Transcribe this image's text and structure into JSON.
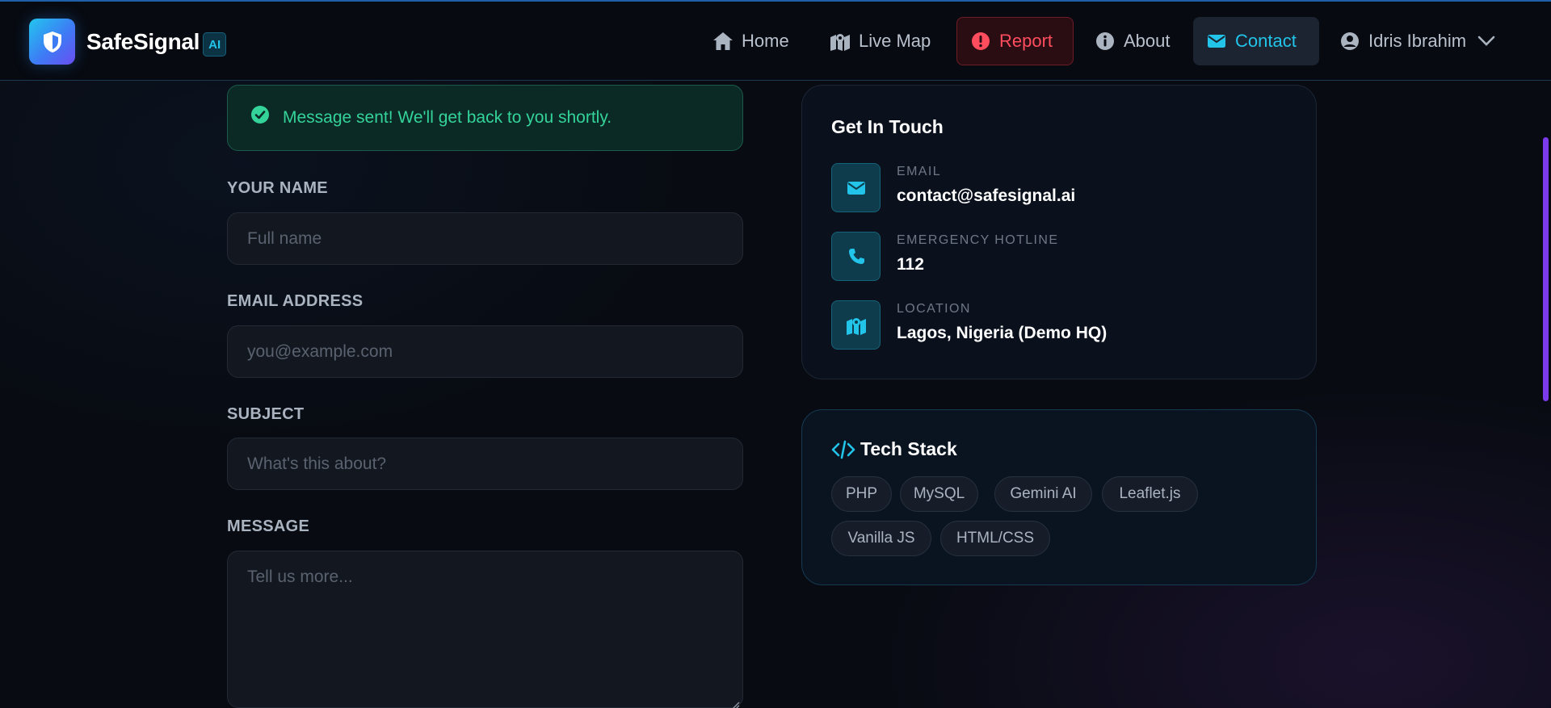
{
  "brand": {
    "name": "SafeSignal",
    "badge": "AI"
  },
  "nav": {
    "home": "Home",
    "live_map": "Live Map",
    "report": "Report",
    "about": "About",
    "contact": "Contact",
    "user": "Idris Ibrahim"
  },
  "alert": {
    "message": "Message sent! We'll get back to you shortly."
  },
  "form": {
    "name_label": "YOUR NAME",
    "name_placeholder": "Full name",
    "email_label": "EMAIL ADDRESS",
    "email_placeholder": "you@example.com",
    "subject_label": "SUBJECT",
    "subject_placeholder": "What's this about?",
    "message_label": "MESSAGE",
    "message_placeholder": "Tell us more..."
  },
  "contact_card": {
    "title": "Get In Touch",
    "items": [
      {
        "label": "EMAIL",
        "value": "contact@safesignal.ai",
        "icon": "envelope-icon"
      },
      {
        "label": "EMERGENCY HOTLINE",
        "value": "112",
        "icon": "phone-icon"
      },
      {
        "label": "LOCATION",
        "value": "Lagos, Nigeria (Demo HQ)",
        "icon": "map-location-icon"
      }
    ]
  },
  "tech_card": {
    "title": "Tech Stack",
    "icon": "code-icon",
    "chips": [
      "PHP",
      "MySQL",
      "Gemini AI",
      "Leaflet.js",
      "Vanilla JS",
      "HTML/CSS"
    ]
  },
  "colors": {
    "accent": "#22c4ea",
    "report": "#ff4d5e",
    "success": "#34d399",
    "scrollbar": "#7c3aed"
  }
}
